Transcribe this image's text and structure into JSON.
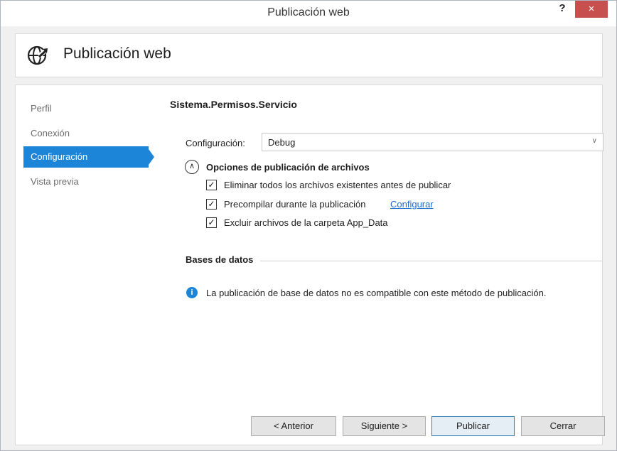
{
  "window": {
    "title": "Publicación web",
    "help_label": "?",
    "close_label": "×"
  },
  "header": {
    "icon": "globe-publish-icon",
    "title": "Publicación web"
  },
  "nav": {
    "items": [
      {
        "label": "Perfil",
        "active": false
      },
      {
        "label": "Conexión",
        "active": false
      },
      {
        "label": "Configuración",
        "active": true
      },
      {
        "label": "Vista previa",
        "active": false
      }
    ]
  },
  "main": {
    "project_name": "Sistema.Permisos.Servicio",
    "config_label": "Configuración:",
    "config_value": "Debug",
    "options_title": "Opciones de publicación de archivos",
    "options": [
      {
        "label": "Eliminar todos los archivos existentes antes de publicar",
        "checked": true
      },
      {
        "label": "Precompilar durante la publicación",
        "checked": true
      },
      {
        "label": "Excluir archivos de la carpeta App_Data",
        "checked": true
      }
    ],
    "configure_link": "Configurar",
    "databases_title": "Bases de datos",
    "databases_info": "La publicación de base de datos no es compatible con este método de publicación."
  },
  "buttons": {
    "previous": "< Anterior",
    "next": "Siguiente >",
    "publish": "Publicar",
    "close": "Cerrar"
  },
  "colors": {
    "accent": "#1c85d8",
    "close_button": "#c7504f",
    "link": "#1c6dd0"
  }
}
